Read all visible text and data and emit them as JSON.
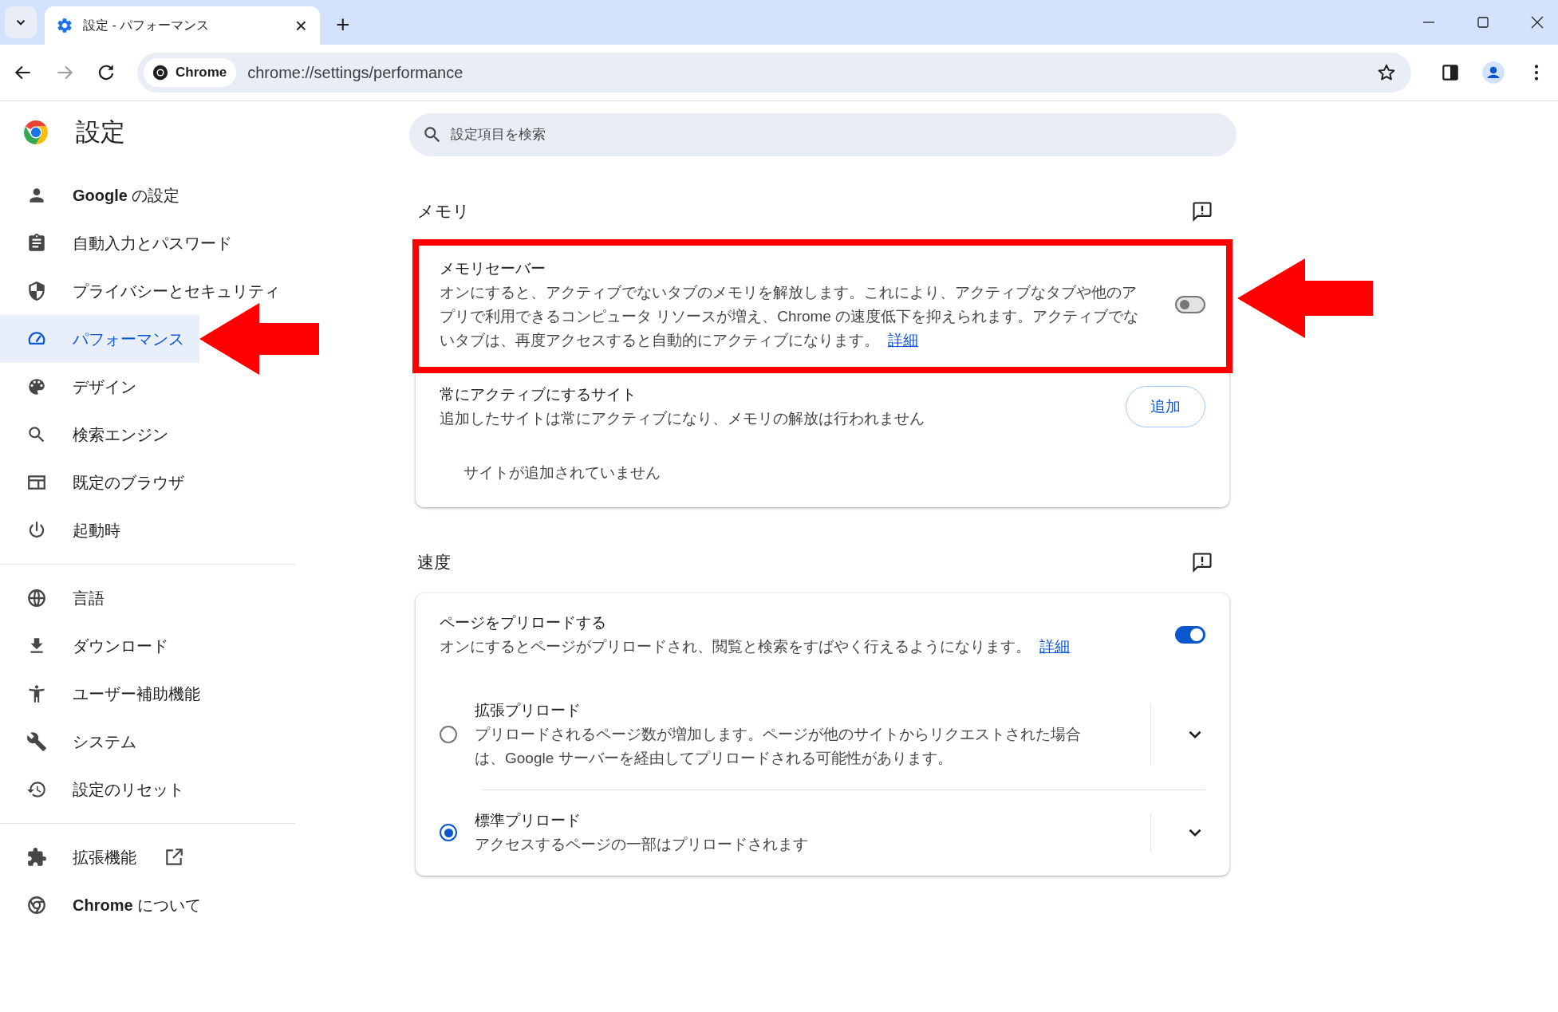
{
  "browser": {
    "tab": {
      "title": "設定 - パフォーマンス",
      "close": "×"
    },
    "new_tab": "+",
    "address": {
      "chip": "Chrome",
      "url": "chrome://settings/performance"
    }
  },
  "header": {
    "title": "設定",
    "search": {
      "placeholder": "設定項目を検索"
    }
  },
  "sidebar": {
    "groups": [
      [
        {
          "kind": "person",
          "label": "**Google** の設定",
          "selected": false,
          "pointed": false
        },
        {
          "kind": "clipboard",
          "label": "自動入力とパスワード",
          "selected": false,
          "pointed": false
        },
        {
          "kind": "shield",
          "label": "プライバシーとセキュリティ",
          "selected": false,
          "pointed": false
        },
        {
          "kind": "gauge",
          "label": "パフォーマンス",
          "selected": true,
          "pointed": true
        },
        {
          "kind": "palette",
          "label": "デザイン",
          "selected": false,
          "pointed": false
        },
        {
          "kind": "search",
          "label": "検索エンジン",
          "selected": false,
          "pointed": false
        },
        {
          "kind": "browser-window",
          "label": "既定のブラウザ",
          "selected": false,
          "pointed": false
        },
        {
          "kind": "power",
          "label": "起動時",
          "selected": false,
          "pointed": false
        }
      ],
      [
        {
          "kind": "globe",
          "label": "言語",
          "selected": false,
          "pointed": false
        },
        {
          "kind": "download",
          "label": "ダウンロード",
          "selected": false,
          "pointed": false
        },
        {
          "kind": "accessibility",
          "label": "ユーザー補助機能",
          "selected": false,
          "pointed": false
        },
        {
          "kind": "wrench",
          "label": "システム",
          "selected": false,
          "pointed": false
        },
        {
          "kind": "history",
          "label": "設定のリセット",
          "selected": false,
          "pointed": false
        }
      ],
      [
        {
          "kind": "puzzle",
          "label": "拡張機能",
          "selected": false,
          "pointed": false,
          "external": true
        },
        {
          "kind": "chrome-logo",
          "label": "**Chrome** について",
          "selected": false,
          "pointed": false
        }
      ]
    ]
  },
  "sections": [
    {
      "title": "メモリ",
      "rows": [
        {
          "kind": "toggle",
          "title": "メモリセーバー",
          "description": "オンにすると、アクティブでないタブのメモリを解放します。これにより、アクティブなタブや他のアプリで利用できるコンピュータ リソースが増え、Chrome の速度低下を抑えられます。アクティブでないタブは、再度アクセスすると自動的にアクティブになります。",
          "link": "詳細",
          "on": false,
          "highlighted": true
        },
        {
          "kind": "site-list",
          "title": "常にアクティブにするサイト",
          "description": "追加したサイトは常にアクティブになり、メモリの解放は行われません",
          "button": "追加",
          "empty": "サイトが追加されていません"
        }
      ]
    },
    {
      "title": "速度",
      "rows": [
        {
          "kind": "toggle",
          "title": "ページをプリロードする",
          "description": "オンにするとページがプリロードされ、閲覧と検索をすばやく行えるようになります。",
          "link": "詳細",
          "on": true,
          "highlighted": false
        },
        {
          "kind": "radio",
          "title": "拡張プリロード",
          "description": "プリロードされるページ数が増加します。ページが他のサイトからリクエストされた場合は、Google サーバーを経由してプリロードされる可能性があります。",
          "selected": false
        },
        {
          "kind": "radio",
          "title": "標準プリロード",
          "description": "アクセスするページの一部はプリロードされます",
          "selected": true
        }
      ]
    }
  ]
}
